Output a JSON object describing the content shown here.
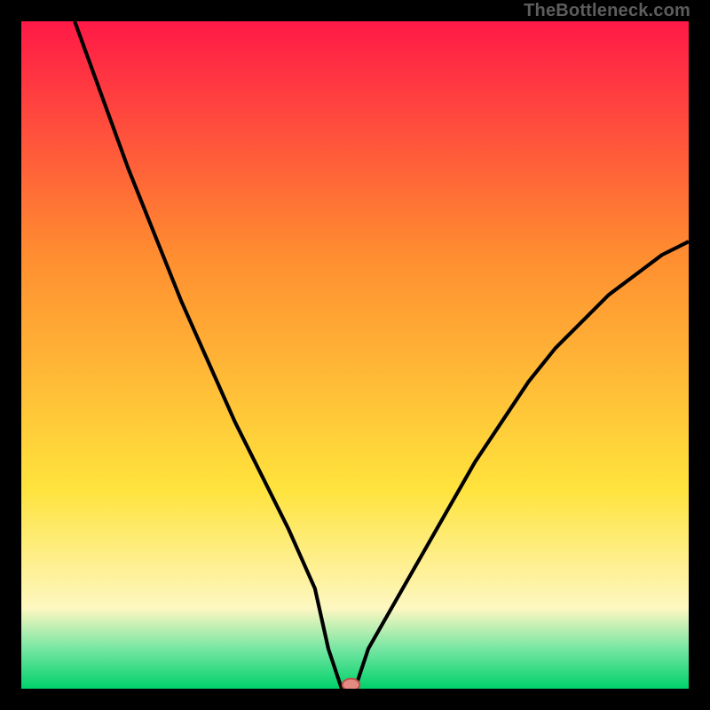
{
  "watermark": "TheBottleneck.com",
  "colors": {
    "bg": "#000000",
    "curve": "#000000",
    "marker_fill": "#e38a82",
    "marker_stroke": "#b84f49",
    "grad_top": "#ff1947",
    "grad_mid_orange": "#ff8d30",
    "grad_yellow": "#ffe33c",
    "grad_cream": "#fdf7c1",
    "grad_mint": "#77e6a3",
    "grad_green": "#00d16a"
  },
  "chart_data": {
    "type": "line",
    "title": "",
    "xlabel": "",
    "ylabel": "",
    "xlim": [
      0,
      100
    ],
    "ylim": [
      0,
      100
    ],
    "legend": false,
    "grid": false,
    "minimum_marker": {
      "x": 48,
      "y": 0
    },
    "series": [
      {
        "name": "bottleneck-curve",
        "x": [
          8,
          12,
          16,
          20,
          24,
          28,
          32,
          36,
          40,
          44,
          46,
          48,
          52,
          56,
          60,
          64,
          68,
          72,
          76,
          80,
          84,
          88,
          92,
          96,
          100
        ],
        "y": [
          100,
          89,
          78,
          68,
          58,
          49,
          40,
          32,
          24,
          15,
          6,
          0,
          6,
          13,
          20,
          27,
          34,
          40,
          46,
          51,
          55,
          59,
          62,
          65,
          67
        ]
      }
    ],
    "background_gradient": {
      "direction": "vertical",
      "stops": [
        {
          "pos": 0.0,
          "color": "#ff1947"
        },
        {
          "pos": 0.35,
          "color": "#ff8d30"
        },
        {
          "pos": 0.7,
          "color": "#ffe33c"
        },
        {
          "pos": 0.88,
          "color": "#fdf7c1"
        },
        {
          "pos": 0.94,
          "color": "#77e6a3"
        },
        {
          "pos": 1.0,
          "color": "#00d16a"
        }
      ]
    }
  }
}
